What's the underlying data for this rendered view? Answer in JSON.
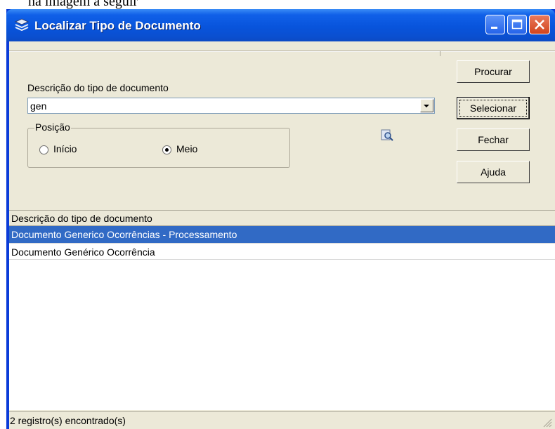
{
  "above_text": "na imagem a seguir",
  "window": {
    "title": "Localizar Tipo de Documento"
  },
  "form": {
    "description_label": "Descrição do tipo de documento",
    "description_value": "gen",
    "position_group_label": "Posição",
    "radio_start_label": "Início",
    "radio_middle_label": "Meio",
    "selected_position": "Meio"
  },
  "buttons": {
    "search": "Procurar",
    "select": "Selecionar",
    "close": "Fechar",
    "help": "Ajuda"
  },
  "list": {
    "column_header": "Descrição do tipo de documento",
    "rows": [
      "Documento Generico Ocorrências - Processamento",
      "Documento Genérico Ocorrência"
    ],
    "selected_index": 0
  },
  "status": {
    "text": "2 registro(s) encontrado(s)"
  },
  "icons": {
    "app": "app-icon",
    "find": "find-icon",
    "dropdown": "chevron-down-icon",
    "minimize": "minimize-icon",
    "maximize": "maximize-icon",
    "close": "close-icon"
  },
  "colors": {
    "titlebar": "#0a4fd0",
    "selection": "#316ac5",
    "close_button": "#d2451d",
    "dialog_bg": "#ece9d8"
  }
}
